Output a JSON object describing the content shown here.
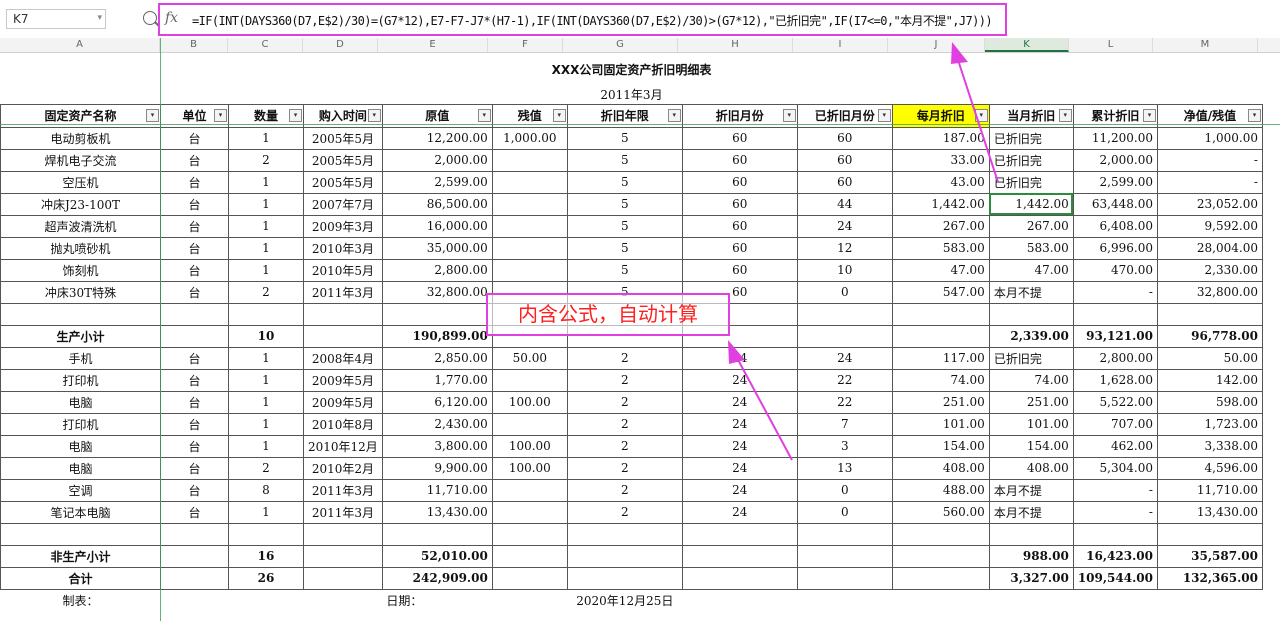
{
  "name_box": "K7",
  "fx_label": "fx",
  "formula": "=IF(INT(DAYS360(D7,E$2)/30)=(G7*12),E7-F7-J7*(H7-1),IF(INT(DAYS360(D7,E$2)/30)>(G7*12),\"已折旧完\",IF(I7<=0,\"本月不提\",J7)))",
  "columns": [
    "A",
    "B",
    "C",
    "D",
    "E",
    "F",
    "G",
    "H",
    "I",
    "J",
    "K",
    "L",
    "M"
  ],
  "title": "XXX公司固定资产折旧明细表",
  "period": "2011年3月",
  "headers": [
    "固定资产名称",
    "单位",
    "数量",
    "购入时间",
    "原值",
    "残值",
    "折旧年限",
    "折旧月份",
    "已折旧月份",
    "每月折旧",
    "当月折旧",
    "累计折旧",
    "净值/残值"
  ],
  "filter_glyph": "▾",
  "rows_a": [
    [
      "电动剪板机",
      "台",
      "1",
      "2005年5月",
      "12,200.00",
      "1,000.00",
      "5",
      "60",
      "60",
      "187.00",
      "已折旧完",
      "11,200.00",
      "1,000.00"
    ],
    [
      "焊机电子交流",
      "台",
      "2",
      "2005年5月",
      "2,000.00",
      "",
      "5",
      "60",
      "60",
      "33.00",
      "已折旧完",
      "2,000.00",
      "-"
    ],
    [
      "空压机",
      "台",
      "1",
      "2005年5月",
      "2,599.00",
      "",
      "5",
      "60",
      "60",
      "43.00",
      "已折旧完",
      "2,599.00",
      "-"
    ],
    [
      "冲床J23-100T",
      "台",
      "1",
      "2007年7月",
      "86,500.00",
      "",
      "5",
      "60",
      "44",
      "1,442.00",
      "1,442.00",
      "63,448.00",
      "23,052.00"
    ],
    [
      "超声波清洗机",
      "台",
      "1",
      "2009年3月",
      "16,000.00",
      "",
      "5",
      "60",
      "24",
      "267.00",
      "267.00",
      "6,408.00",
      "9,592.00"
    ],
    [
      "抛丸喷砂机",
      "台",
      "1",
      "2010年3月",
      "35,000.00",
      "",
      "5",
      "60",
      "12",
      "583.00",
      "583.00",
      "6,996.00",
      "28,004.00"
    ],
    [
      "饰刻机",
      "台",
      "1",
      "2010年5月",
      "2,800.00",
      "",
      "5",
      "60",
      "10",
      "47.00",
      "47.00",
      "470.00",
      "2,330.00"
    ],
    [
      "冲床30T特殊",
      "台",
      "2",
      "2011年3月",
      "32,800.00",
      "",
      "5",
      "60",
      "0",
      "547.00",
      "本月不提",
      "-",
      "32,800.00"
    ]
  ],
  "subtotal_a": [
    "生产小计",
    "",
    "10",
    "",
    "190,899.00",
    "",
    "",
    "",
    "",
    "",
    "2,339.00",
    "93,121.00",
    "96,778.00"
  ],
  "rows_b": [
    [
      "手机",
      "台",
      "1",
      "2008年4月",
      "2,850.00",
      "50.00",
      "2",
      "24",
      "24",
      "117.00",
      "已折旧完",
      "2,800.00",
      "50.00"
    ],
    [
      "打印机",
      "台",
      "1",
      "2009年5月",
      "1,770.00",
      "",
      "2",
      "24",
      "22",
      "74.00",
      "74.00",
      "1,628.00",
      "142.00"
    ],
    [
      "电脑",
      "台",
      "1",
      "2009年5月",
      "6,120.00",
      "100.00",
      "2",
      "24",
      "22",
      "251.00",
      "251.00",
      "5,522.00",
      "598.00"
    ],
    [
      "打印机",
      "台",
      "1",
      "2010年8月",
      "2,430.00",
      "",
      "2",
      "24",
      "7",
      "101.00",
      "101.00",
      "707.00",
      "1,723.00"
    ],
    [
      "电脑",
      "台",
      "1",
      "2010年12月",
      "3,800.00",
      "100.00",
      "2",
      "24",
      "3",
      "154.00",
      "154.00",
      "462.00",
      "3,338.00"
    ],
    [
      "电脑",
      "台",
      "2",
      "2010年2月",
      "9,900.00",
      "100.00",
      "2",
      "24",
      "13",
      "408.00",
      "408.00",
      "5,304.00",
      "4,596.00"
    ],
    [
      "空调",
      "台",
      "8",
      "2011年3月",
      "11,710.00",
      "",
      "2",
      "24",
      "0",
      "488.00",
      "本月不提",
      "-",
      "11,710.00"
    ],
    [
      "笔记本电脑",
      "台",
      "1",
      "2011年3月",
      "13,430.00",
      "",
      "2",
      "24",
      "0",
      "560.00",
      "本月不提",
      "-",
      "13,430.00"
    ]
  ],
  "subtotal_b": [
    "非生产小计",
    "",
    "16",
    "",
    "52,010.00",
    "",
    "",
    "",
    "",
    "",
    "988.00",
    "16,423.00",
    "35,587.00"
  ],
  "total": [
    "合计",
    "",
    "26",
    "",
    "242,909.00",
    "",
    "",
    "",
    "",
    "",
    "3,327.00",
    "109,544.00",
    "132,365.00"
  ],
  "footer": {
    "maker": "制表：",
    "date_label": "日期：",
    "date_value": "2020年12月25日"
  },
  "annotation": "内含公式，自动计算",
  "colors": {
    "annotation_border": "#e040e0",
    "annotation_text": "#ff2020",
    "highlight": "#ffff00",
    "selection": "#2e8b3d"
  }
}
